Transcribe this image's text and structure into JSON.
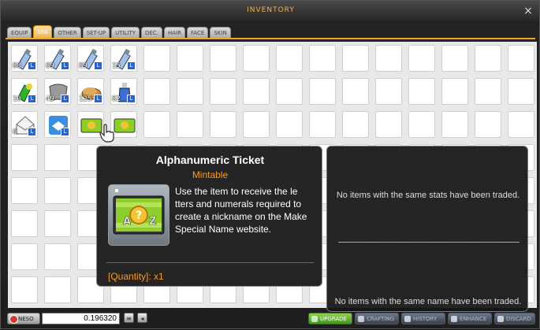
{
  "window": {
    "title": "INVENTORY",
    "close_glyph": "×"
  },
  "tabs": [
    "EQUIP",
    "USE",
    "OTHER",
    "SET-UP",
    "UTILITY",
    "DEC.",
    "HAIR",
    "FACE",
    "SKIN"
  ],
  "active_tab": "USE",
  "slots": [
    {
      "icon": "potion-bottle-icon",
      "qty": "88"
    },
    {
      "icon": "potion-bottle-icon",
      "qty": "89"
    },
    {
      "icon": "potion-bottle-icon",
      "qty": "89"
    },
    {
      "icon": "potion-bottle-icon",
      "qty": "15"
    },
    {
      "icon": "green-elixir-icon",
      "qty": "10"
    },
    {
      "icon": "gray-cloth-icon",
      "qty": "49"
    },
    {
      "icon": "bread-icon",
      "qty": "125"
    },
    {
      "icon": "blue-potion-icon",
      "qty": "82"
    },
    {
      "icon": "envelope-icon",
      "qty": "6"
    },
    {
      "icon": "blue-bird-scroll-icon",
      "qty": ""
    },
    {
      "icon": "ticket-icon",
      "qty": ""
    },
    {
      "icon": "ticket-icon",
      "qty": ""
    }
  ],
  "tooltip": {
    "name": "Alphanumeric Ticket",
    "subtitle": "Mintable",
    "description": "Use the item to receive the le tters and numerals required to create a nickname on the Make Special Name website.",
    "quantity": "[Quantity]: x1"
  },
  "trade_panel": {
    "stats_message": "No items with the same stats have been traded.",
    "name_message": "No items with the same name have been traded."
  },
  "bottom": {
    "neso_label": "NESO",
    "neso_value": "0.196320",
    "buttons": [
      "UPGRADE",
      "CRAFTING",
      "HISTORY",
      "ENHANCE",
      "DISCARD"
    ]
  },
  "colors": {
    "accent": "#f0b24a",
    "orange_text": "#ff9a1e",
    "lock_badge": "#2b63c8"
  }
}
